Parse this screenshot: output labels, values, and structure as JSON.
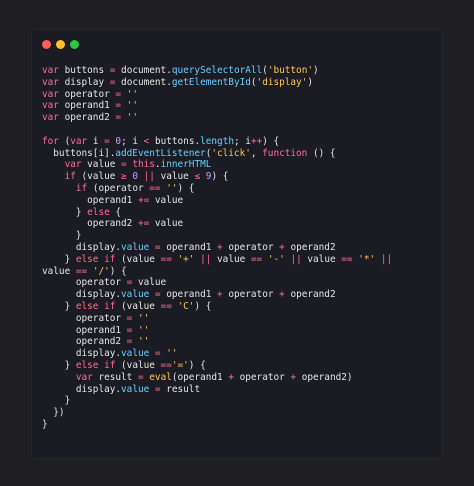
{
  "window_buttons": {
    "close_color": "#ff5f57",
    "minimize_color": "#febc2e",
    "maximize_color": "#28c840"
  },
  "code_lines": [
    [
      [
        "kw",
        "var"
      ],
      [
        "var",
        " buttons "
      ],
      [
        "op",
        "="
      ],
      [
        "var",
        " document."
      ],
      [
        "prop",
        "querySelectorAll"
      ],
      [
        "var",
        "("
      ],
      [
        "str",
        "'button'"
      ],
      [
        "var",
        ")"
      ]
    ],
    [
      [
        "kw",
        "var"
      ],
      [
        "var",
        " display "
      ],
      [
        "op",
        "="
      ],
      [
        "var",
        " document."
      ],
      [
        "prop",
        "getElementById"
      ],
      [
        "var",
        "("
      ],
      [
        "str",
        "'display'"
      ],
      [
        "var",
        ")"
      ]
    ],
    [
      [
        "kw",
        "var"
      ],
      [
        "var",
        " operator "
      ],
      [
        "op",
        "="
      ],
      [
        "var",
        " "
      ],
      [
        "str",
        "''"
      ]
    ],
    [
      [
        "kw",
        "var"
      ],
      [
        "var",
        " operand1 "
      ],
      [
        "op",
        "="
      ],
      [
        "var",
        " "
      ],
      [
        "str",
        "''"
      ]
    ],
    [
      [
        "kw",
        "var"
      ],
      [
        "var",
        " operand2 "
      ],
      [
        "op",
        "="
      ],
      [
        "var",
        " "
      ],
      [
        "str",
        "''"
      ]
    ],
    [
      [
        "var",
        ""
      ]
    ],
    [
      [
        "kw",
        "for"
      ],
      [
        "var",
        " ("
      ],
      [
        "kw",
        "var"
      ],
      [
        "var",
        " i "
      ],
      [
        "op",
        "="
      ],
      [
        "var",
        " "
      ],
      [
        "num",
        "0"
      ],
      [
        "var",
        "; i "
      ],
      [
        "op",
        "<"
      ],
      [
        "var",
        " buttons."
      ],
      [
        "prop",
        "length"
      ],
      [
        "var",
        "; i"
      ],
      [
        "op",
        "++"
      ],
      [
        "var",
        ") {"
      ]
    ],
    [
      [
        "var",
        "  buttons[i]."
      ],
      [
        "prop",
        "addEventListener"
      ],
      [
        "var",
        "("
      ],
      [
        "str",
        "'click'"
      ],
      [
        "var",
        ", "
      ],
      [
        "kw",
        "function"
      ],
      [
        "var",
        " () {"
      ]
    ],
    [
      [
        "var",
        "    "
      ],
      [
        "kw",
        "var"
      ],
      [
        "var",
        " value "
      ],
      [
        "op",
        "="
      ],
      [
        "var",
        " "
      ],
      [
        "kw",
        "this"
      ],
      [
        "var",
        "."
      ],
      [
        "prop",
        "innerHTML"
      ]
    ],
    [
      [
        "var",
        "    "
      ],
      [
        "kw",
        "if"
      ],
      [
        "var",
        " (value "
      ],
      [
        "op",
        "≥"
      ],
      [
        "var",
        " "
      ],
      [
        "num",
        "0"
      ],
      [
        "var",
        " "
      ],
      [
        "op",
        "||"
      ],
      [
        "var",
        " value "
      ],
      [
        "op",
        "≤"
      ],
      [
        "var",
        " "
      ],
      [
        "num",
        "9"
      ],
      [
        "var",
        ") {"
      ]
    ],
    [
      [
        "var",
        "      "
      ],
      [
        "kw",
        "if"
      ],
      [
        "var",
        " (operator "
      ],
      [
        "op",
        "=="
      ],
      [
        "var",
        " "
      ],
      [
        "str",
        "''"
      ],
      [
        "var",
        ") {"
      ]
    ],
    [
      [
        "var",
        "        operand1 "
      ],
      [
        "op",
        "+="
      ],
      [
        "var",
        " value"
      ]
    ],
    [
      [
        "var",
        "      } "
      ],
      [
        "kw",
        "else"
      ],
      [
        "var",
        " {"
      ]
    ],
    [
      [
        "var",
        "        operand2 "
      ],
      [
        "op",
        "+="
      ],
      [
        "var",
        " value"
      ]
    ],
    [
      [
        "var",
        "      }"
      ]
    ],
    [
      [
        "var",
        "      display."
      ],
      [
        "prop",
        "value"
      ],
      [
        "var",
        " "
      ],
      [
        "op",
        "="
      ],
      [
        "var",
        " operand1 "
      ],
      [
        "op",
        "+"
      ],
      [
        "var",
        " operator "
      ],
      [
        "op",
        "+"
      ],
      [
        "var",
        " operand2"
      ]
    ],
    [
      [
        "var",
        "    } "
      ],
      [
        "kw",
        "else if"
      ],
      [
        "var",
        " (value "
      ],
      [
        "op",
        "=="
      ],
      [
        "var",
        " "
      ],
      [
        "str",
        "'+'"
      ],
      [
        "var",
        " "
      ],
      [
        "op",
        "||"
      ],
      [
        "var",
        " value "
      ],
      [
        "op",
        "=="
      ],
      [
        "var",
        " "
      ],
      [
        "str",
        "'-'"
      ],
      [
        "var",
        " "
      ],
      [
        "op",
        "||"
      ],
      [
        "var",
        " value "
      ],
      [
        "op",
        "=="
      ],
      [
        "var",
        " "
      ],
      [
        "str",
        "'*'"
      ],
      [
        "var",
        " "
      ],
      [
        "op",
        "||"
      ]
    ],
    [
      [
        "var",
        "value "
      ],
      [
        "op",
        "=="
      ],
      [
        "var",
        " "
      ],
      [
        "str",
        "'/'"
      ],
      [
        "var",
        ") {"
      ]
    ],
    [
      [
        "var",
        "      operator "
      ],
      [
        "op",
        "="
      ],
      [
        "var",
        " value"
      ]
    ],
    [
      [
        "var",
        "      display."
      ],
      [
        "prop",
        "value"
      ],
      [
        "var",
        " "
      ],
      [
        "op",
        "="
      ],
      [
        "var",
        " operand1 "
      ],
      [
        "op",
        "+"
      ],
      [
        "var",
        " operator "
      ],
      [
        "op",
        "+"
      ],
      [
        "var",
        " operand2"
      ]
    ],
    [
      [
        "var",
        "    } "
      ],
      [
        "kw",
        "else if"
      ],
      [
        "var",
        " (value "
      ],
      [
        "op",
        "=="
      ],
      [
        "var",
        " "
      ],
      [
        "str",
        "'C'"
      ],
      [
        "var",
        ") {"
      ]
    ],
    [
      [
        "var",
        "      operator "
      ],
      [
        "op",
        "="
      ],
      [
        "var",
        " "
      ],
      [
        "str",
        "''"
      ]
    ],
    [
      [
        "var",
        "      operand1 "
      ],
      [
        "op",
        "="
      ],
      [
        "var",
        " "
      ],
      [
        "str",
        "''"
      ]
    ],
    [
      [
        "var",
        "      operand2 "
      ],
      [
        "op",
        "="
      ],
      [
        "var",
        " "
      ],
      [
        "str",
        "''"
      ]
    ],
    [
      [
        "var",
        "      display."
      ],
      [
        "prop",
        "value"
      ],
      [
        "var",
        " "
      ],
      [
        "op",
        "="
      ],
      [
        "var",
        " "
      ],
      [
        "str",
        "''"
      ]
    ],
    [
      [
        "var",
        "    } "
      ],
      [
        "kw",
        "else if"
      ],
      [
        "var",
        " (value "
      ],
      [
        "op",
        "=="
      ],
      [
        "str",
        "'='"
      ],
      [
        "var",
        ") {"
      ]
    ],
    [
      [
        "var",
        "      "
      ],
      [
        "kw",
        "var"
      ],
      [
        "var",
        " result "
      ],
      [
        "op",
        "="
      ],
      [
        "var",
        " "
      ],
      [
        "fn",
        "eval"
      ],
      [
        "var",
        "(operand1 "
      ],
      [
        "op",
        "+"
      ],
      [
        "var",
        " operator "
      ],
      [
        "op",
        "+"
      ],
      [
        "var",
        " operand2)"
      ]
    ],
    [
      [
        "var",
        "      display."
      ],
      [
        "prop",
        "value"
      ],
      [
        "var",
        " "
      ],
      [
        "op",
        "="
      ],
      [
        "var",
        " result"
      ]
    ],
    [
      [
        "var",
        "    }"
      ]
    ],
    [
      [
        "var",
        "  })"
      ]
    ],
    [
      [
        "var",
        "}"
      ]
    ]
  ]
}
